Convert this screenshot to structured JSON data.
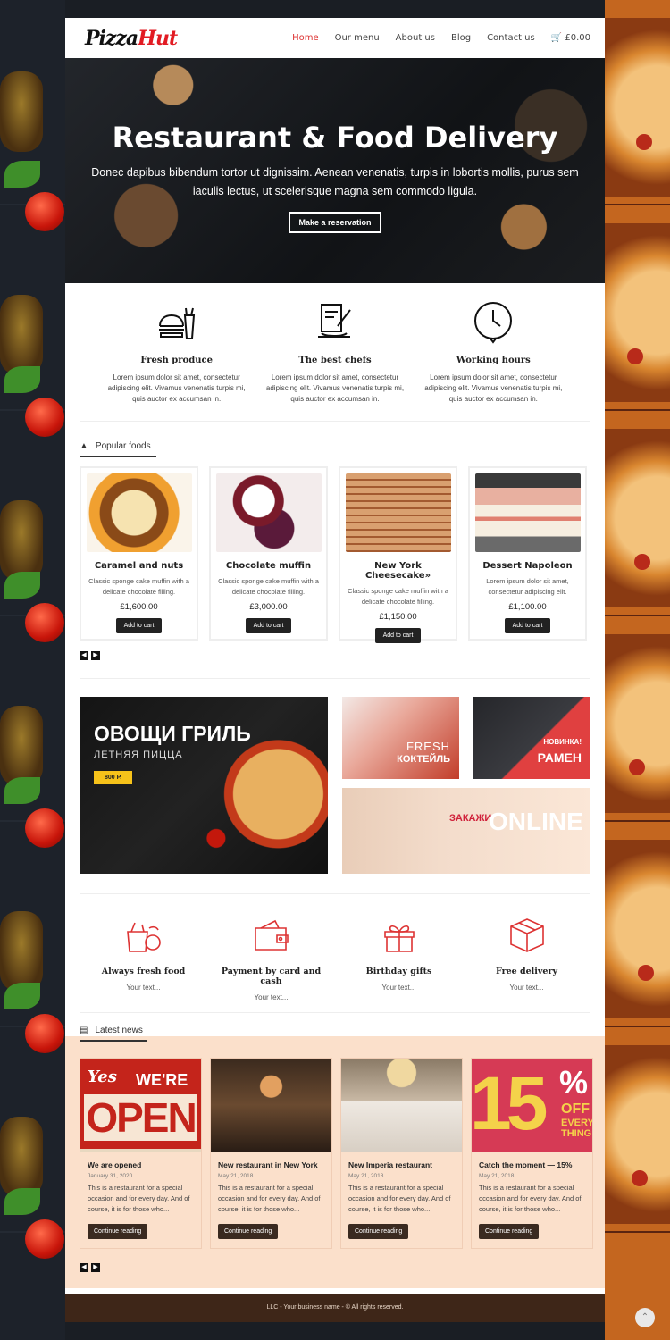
{
  "header": {
    "logo_part1": "Pizza",
    "logo_part2": "Hut",
    "nav": [
      "Home",
      "Our menu",
      "About us",
      "Blog",
      "Contact us"
    ],
    "cart": "£0.00"
  },
  "hero": {
    "title": "Restaurant & Food Delivery",
    "text": "Donec dapibus bibendum tortor ut dignissim. Aenean venenatis, turpis in lobortis mollis, purus sem iaculis lectus, ut scelerisque magna sem commodo ligula.",
    "button": "Make a reservation"
  },
  "features": [
    {
      "title": "Fresh produce",
      "text": "Lorem ipsum dolor sit amet, consectetur adipiscing elit. Vivamus venenatis turpis mi, quis auctor ex accumsan in.",
      "icon": "burger-fries-icon"
    },
    {
      "title": "The best chefs",
      "text": "Lorem ipsum dolor sit amet, consectetur adipiscing elit. Vivamus venenatis turpis mi, quis auctor ex accumsan in.",
      "icon": "chef-tools-icon"
    },
    {
      "title": "Working hours",
      "text": "Lorem ipsum dolor sit amet, consectetur adipiscing elit. Vivamus venenatis turpis mi, quis auctor ex accumsan in.",
      "icon": "clock-icon"
    }
  ],
  "popular": {
    "title": "Popular foods",
    "products": [
      {
        "name": "Caramel and nuts",
        "desc": "Classic sponge cake muffin with a delicate chocolate filling.",
        "price": "£1,600.00",
        "button": "Add to cart"
      },
      {
        "name": "Chocolate muffin",
        "desc": "Classic sponge cake muffin with a delicate chocolate filling.",
        "price": "£3,000.00",
        "button": "Add to cart"
      },
      {
        "name": "New York Cheesecake»",
        "desc": "Classic sponge cake muffin with a delicate chocolate filling.",
        "price": "£1,150.00",
        "button": "Add to cart"
      },
      {
        "name": "Dessert Napoleon",
        "desc": "Lorem ipsum dolor sit amet, consectetur adipiscing elit.",
        "price": "£1,100.00",
        "button": "Add to cart"
      }
    ]
  },
  "banners": {
    "main_big": "ОВОЩИ ГРИЛЬ",
    "main_sub": "ЛЕТНЯЯ ПИЦЦА",
    "main_price": "800 Р.",
    "b1_line1": "FRESH",
    "b1_line2": "КОКТЕЙЛЬ",
    "b2_line1": "НОВИНКА!",
    "b2_line2": "РАМЕН",
    "b3_line1": "ЗАКАЖИ",
    "b3_line2": "ONLINE"
  },
  "services": [
    {
      "title": "Always fresh food",
      "text": "Your text...",
      "icon": "grocery-bag-icon"
    },
    {
      "title": "Payment by card and cash",
      "text": "Your text...",
      "icon": "wallet-icon"
    },
    {
      "title": "Birthday gifts",
      "text": "Your text...",
      "icon": "gift-icon"
    },
    {
      "title": "Free delivery",
      "text": "Your text...",
      "icon": "box-icon"
    }
  ],
  "news": {
    "title": "Latest news",
    "items": [
      {
        "title": "We are opened",
        "date": "January 31, 2020",
        "text": "This is a restaurant for a special occasion and for every day. And of course, it is for those who...",
        "button": "Continue reading",
        "img_text1": "Yes",
        "img_text2": "WE'RE",
        "img_text3": "OPEN"
      },
      {
        "title": "New restaurant in New York",
        "date": "May 21, 2018",
        "text": "This is a restaurant for a special occasion and for every day. And of course, it is for those who...",
        "button": "Continue reading"
      },
      {
        "title": "New Imperia restaurant",
        "date": "May 21, 2018",
        "text": "This is a restaurant for a special occasion and for every day. And of course, it is for those who...",
        "button": "Continue reading"
      },
      {
        "title": "Catch the moment — 15%",
        "date": "May 21, 2018",
        "text": "This is a restaurant for a special occasion and for every day. And of course, it is for those who...",
        "button": "Continue reading",
        "img_text1": "15",
        "img_text2": "%",
        "img_text3": "OFF",
        "img_text4": "EVERY",
        "img_text5": "THING"
      }
    ]
  },
  "footer": {
    "text": "LLC - Your business name - © All rights reserved."
  },
  "colors": {
    "accent": "#e21b23",
    "news_bg": "#fbe0cb",
    "footer_bg": "#3e2618"
  }
}
